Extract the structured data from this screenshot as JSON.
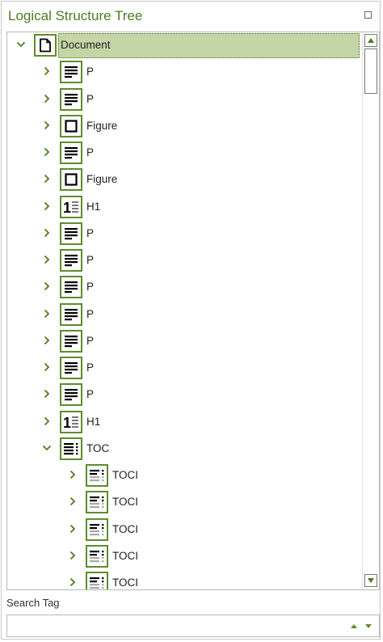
{
  "panel": {
    "title": "Logical Structure Tree"
  },
  "accent": "#5f8c2c",
  "selection_color": "#c4d6a5",
  "tree": [
    {
      "label": "Document",
      "icon": "document-icon",
      "depth": 0,
      "expanded": true,
      "selected": true
    },
    {
      "label": "P",
      "icon": "paragraph-icon",
      "depth": 1,
      "expanded": false
    },
    {
      "label": "P",
      "icon": "paragraph-icon",
      "depth": 1,
      "expanded": false
    },
    {
      "label": "Figure",
      "icon": "figure-icon",
      "depth": 1,
      "expanded": false
    },
    {
      "label": "P",
      "icon": "paragraph-icon",
      "depth": 1,
      "expanded": false
    },
    {
      "label": "Figure",
      "icon": "figure-icon",
      "depth": 1,
      "expanded": false
    },
    {
      "label": "H1",
      "icon": "heading-icon",
      "depth": 1,
      "expanded": false
    },
    {
      "label": "P",
      "icon": "paragraph-icon",
      "depth": 1,
      "expanded": false
    },
    {
      "label": "P",
      "icon": "paragraph-icon",
      "depth": 1,
      "expanded": false
    },
    {
      "label": "P",
      "icon": "paragraph-icon",
      "depth": 1,
      "expanded": false
    },
    {
      "label": "P",
      "icon": "paragraph-icon",
      "depth": 1,
      "expanded": false
    },
    {
      "label": "P",
      "icon": "paragraph-icon",
      "depth": 1,
      "expanded": false
    },
    {
      "label": "P",
      "icon": "paragraph-icon",
      "depth": 1,
      "expanded": false
    },
    {
      "label": "P",
      "icon": "paragraph-icon",
      "depth": 1,
      "expanded": false
    },
    {
      "label": "H1",
      "icon": "heading-icon",
      "depth": 1,
      "expanded": false
    },
    {
      "label": "TOC",
      "icon": "toc-icon",
      "depth": 1,
      "expanded": true
    },
    {
      "label": "TOCI",
      "icon": "toci-icon",
      "depth": 2,
      "expanded": false
    },
    {
      "label": "TOCI",
      "icon": "toci-icon",
      "depth": 2,
      "expanded": false
    },
    {
      "label": "TOCI",
      "icon": "toci-icon",
      "depth": 2,
      "expanded": false
    },
    {
      "label": "TOCI",
      "icon": "toci-icon",
      "depth": 2,
      "expanded": false
    },
    {
      "label": "TOCI",
      "icon": "toci-icon",
      "depth": 2,
      "expanded": false
    }
  ],
  "search": {
    "label": "Search Tag",
    "value": "",
    "placeholder": ""
  }
}
